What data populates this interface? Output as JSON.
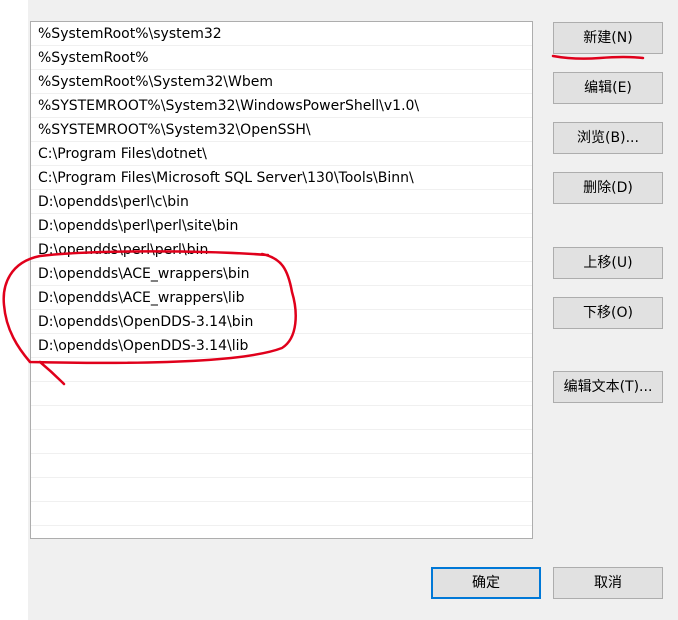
{
  "path_list": {
    "items": [
      "%SystemRoot%\\system32",
      "%SystemRoot%",
      "%SystemRoot%\\System32\\Wbem",
      "%SYSTEMROOT%\\System32\\WindowsPowerShell\\v1.0\\",
      "%SYSTEMROOT%\\System32\\OpenSSH\\",
      "C:\\Program Files\\dotnet\\",
      "C:\\Program Files\\Microsoft SQL Server\\130\\Tools\\Binn\\",
      "D:\\opendds\\perl\\c\\bin",
      "D:\\opendds\\perl\\perl\\site\\bin",
      "D:\\opendds\\perl\\perl\\bin",
      "D:\\opendds\\ACE_wrappers\\bin",
      "D:\\opendds\\ACE_wrappers\\lib",
      "D:\\opendds\\OpenDDS-3.14\\bin",
      "D:\\opendds\\OpenDDS-3.14\\lib"
    ]
  },
  "buttons": {
    "new": "新建(N)",
    "edit": "编辑(E)",
    "browse": "浏览(B)...",
    "delete": "删除(D)",
    "move_up": "上移(U)",
    "move_down": "下移(O)",
    "edit_text": "编辑文本(T)...",
    "ok": "确定",
    "cancel": "取消"
  },
  "colors": {
    "annotation": "#e0001b",
    "focus_border": "#0078d7"
  }
}
